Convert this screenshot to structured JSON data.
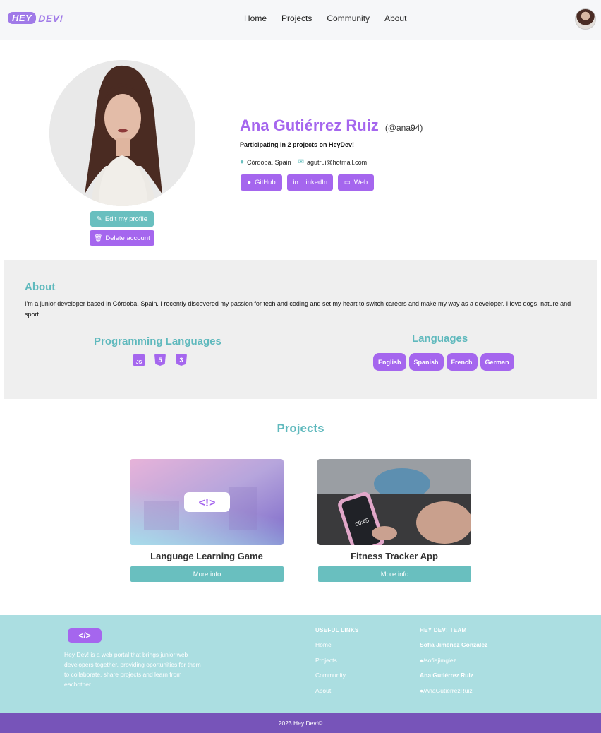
{
  "header": {
    "logo_hey": "HEY",
    "logo_dev": "DEV!",
    "nav": [
      "Home",
      "Projects",
      "Community",
      "About"
    ]
  },
  "profile": {
    "name": "Ana Gutiérrez Ruiz",
    "handle": "(@ana94)",
    "participating": "Participating in 2 projects on HeyDev!",
    "location": "Córdoba, Spain",
    "email": "agutrui@hotmail.com",
    "social": [
      "GitHub",
      "LinkedIn",
      "Web"
    ],
    "edit_label": "Edit my profile",
    "delete_label": "Delete account"
  },
  "about": {
    "title": "About",
    "text": "I'm a junior developer based in Córdoba, Spain. I recently discovered my passion for tech and coding and set my heart to switch careers and make my way as a developer. I love dogs, nature and sport.",
    "programming_title": "Programming Languages",
    "programming": [
      "JS",
      "5",
      "3"
    ],
    "languages_title": "Languages",
    "languages": [
      "English",
      "Spanish",
      "French",
      "German"
    ]
  },
  "projects": {
    "title": "Projects",
    "items": [
      {
        "name": "Language Learning Game",
        "button": "More info"
      },
      {
        "name": "Fitness Tracker App",
        "button": "More info"
      }
    ]
  },
  "footer": {
    "logo": "</>",
    "description": "Hey Dev! is a web portal that brings junior web developers together, providing oportunities for them to collaborate, share projects and learn from eachother.",
    "links_head": "USEFUL LINKS",
    "links": [
      "Home",
      "Projects",
      "Community",
      "About"
    ],
    "team_head": "HEY DEV! TEAM",
    "team": [
      "Sofía Jiménez González",
      "/sofiajimgiez",
      "Ana Gutiérrez Ruiz",
      "/AnaGutierrezRuiz"
    ],
    "copyright": "2023 Hey Dev!©"
  },
  "colors": {
    "purple": "#a566ee",
    "teal": "#69bfbf",
    "footer_bg": "#abdee1",
    "copyright_bg": "#7754b9"
  }
}
